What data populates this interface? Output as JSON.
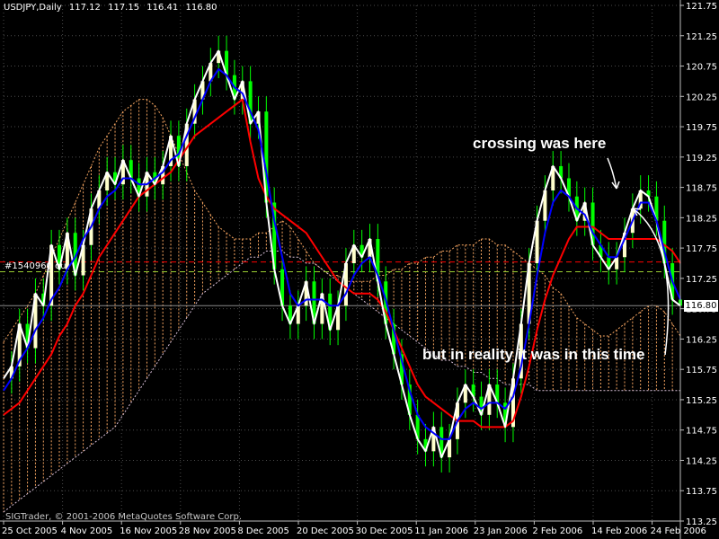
{
  "header": {
    "symbol": "USDJPY,Daily",
    "open": "117.12",
    "high": "117.15",
    "low": "116.41",
    "close": "116.80"
  },
  "copyright": "SIGTrader, © 2001-2006 MetaQuotes Software Corp.",
  "level_label": "#1540960 ou",
  "current_price": "116.80",
  "annotations": {
    "crossing": "crossing was here",
    "reality": "but in reality it was in this time"
  },
  "colors": {
    "background": "#000000",
    "price_line": "#ffffff",
    "tenkan": "#0000ff",
    "kijun": "#ff0000",
    "bull_candle": "#ffffcc",
    "bear_candle": "#00ff00",
    "cloud_up": "#f4a460",
    "cloud_down": "#d8bfd8",
    "grid": "#4a4a4a",
    "level_red": "#ff0000",
    "level_green": "#9acd32"
  },
  "chart_data": {
    "type": "line",
    "title": "USDJPY,Daily",
    "ylim": [
      113.25,
      121.75
    ],
    "y_ticks": [
      "121.75",
      "121.25",
      "120.75",
      "120.25",
      "119.75",
      "119.25",
      "118.75",
      "118.25",
      "117.75",
      "117.25",
      "116.75",
      "116.25",
      "115.75",
      "115.25",
      "114.75",
      "114.25",
      "113.75",
      "113.25"
    ],
    "x_ticks": [
      "25 Oct 2005",
      "4 Nov 2005",
      "16 Nov 2005",
      "28 Nov 2005",
      "8 Dec 2005",
      "20 Dec 2005",
      "30 Dec 2005",
      "11 Jan 2006",
      "23 Jan 2006",
      "2 Feb 2006",
      "14 Feb 2006",
      "24 Feb 2006"
    ],
    "grid": true,
    "levels": [
      {
        "value": 117.52,
        "color": "#ff0000"
      },
      {
        "value": 117.36,
        "color": "#9acd32"
      }
    ],
    "series": [
      {
        "key": "price",
        "values": [
          115.6,
          115.8,
          116.5,
          116.1,
          117.0,
          116.8,
          117.8,
          117.4,
          118.0,
          117.3,
          117.8,
          118.4,
          118.7,
          119.0,
          118.8,
          119.2,
          118.9,
          118.6,
          119.0,
          118.8,
          119.1,
          119.6,
          119.1,
          119.8,
          120.2,
          120.5,
          120.8,
          121.0,
          120.6,
          120.2,
          120.5,
          119.8,
          120.0,
          118.5,
          117.4,
          116.8,
          116.5,
          116.8,
          117.2,
          116.5,
          117.0,
          116.4,
          116.8,
          117.5,
          117.8,
          117.6,
          117.9,
          117.2,
          116.5,
          116.0,
          115.5,
          115.0,
          114.6,
          114.4,
          114.8,
          114.3,
          114.6,
          115.2,
          115.5,
          115.3,
          115.0,
          115.5,
          115.2,
          114.8,
          115.6,
          116.5,
          117.5,
          118.2,
          118.7,
          119.1,
          118.9,
          118.6,
          118.2,
          118.5,
          117.8,
          117.6,
          117.4,
          117.6,
          118.0,
          118.4,
          118.7,
          118.6,
          118.2,
          117.5,
          116.9,
          116.8
        ]
      },
      {
        "key": "tenkan",
        "values": [
          115.4,
          115.6,
          115.9,
          116.1,
          116.4,
          116.6,
          116.9,
          117.1,
          117.4,
          117.6,
          117.9,
          118.1,
          118.4,
          118.6,
          118.7,
          118.9,
          118.9,
          118.8,
          118.8,
          118.9,
          119.0,
          119.2,
          119.3,
          119.6,
          119.9,
          120.2,
          120.5,
          120.7,
          120.6,
          120.4,
          120.3,
          120.0,
          119.7,
          119.0,
          118.2,
          117.6,
          117.0,
          116.8,
          116.9,
          116.9,
          116.9,
          116.8,
          116.8,
          117.0,
          117.3,
          117.5,
          117.6,
          117.3,
          116.9,
          116.4,
          115.9,
          115.4,
          115.0,
          114.8,
          114.7,
          114.6,
          114.6,
          114.9,
          115.1,
          115.2,
          115.1,
          115.2,
          115.2,
          115.1,
          115.3,
          115.8,
          116.5,
          117.3,
          118.0,
          118.5,
          118.7,
          118.6,
          118.4,
          118.3,
          118.0,
          117.8,
          117.6,
          117.6,
          117.9,
          118.2,
          118.5,
          118.5,
          118.2,
          117.7,
          117.2,
          116.9
        ]
      },
      {
        "key": "kijun",
        "values": [
          115.0,
          115.1,
          115.2,
          115.4,
          115.6,
          115.8,
          116.0,
          116.3,
          116.5,
          116.8,
          117.0,
          117.3,
          117.6,
          117.8,
          118.0,
          118.2,
          118.4,
          118.6,
          118.7,
          118.8,
          118.9,
          119.0,
          119.2,
          119.4,
          119.6,
          119.7,
          119.8,
          119.9,
          120.0,
          120.1,
          120.2,
          119.5,
          118.9,
          118.6,
          118.4,
          118.3,
          118.2,
          118.1,
          118.0,
          117.8,
          117.6,
          117.4,
          117.2,
          117.1,
          117.0,
          117.0,
          117.0,
          116.9,
          116.7,
          116.4,
          116.1,
          115.8,
          115.5,
          115.3,
          115.2,
          115.1,
          115.0,
          114.9,
          114.9,
          114.9,
          114.8,
          114.8,
          114.8,
          114.8,
          114.9,
          115.3,
          115.8,
          116.4,
          116.9,
          117.3,
          117.6,
          117.9,
          118.1,
          118.1,
          118.1,
          118.0,
          117.9,
          117.9,
          117.9,
          117.9,
          117.9,
          117.9,
          117.9,
          117.8,
          117.7,
          117.5
        ]
      },
      {
        "key": "span_a",
        "values": [
          116.2,
          116.4,
          116.6,
          116.8,
          117.0,
          117.3,
          117.6,
          117.9,
          118.2,
          118.5,
          118.8,
          119.1,
          119.4,
          119.6,
          119.8,
          120.0,
          120.1,
          120.2,
          120.2,
          120.1,
          119.9,
          119.6,
          119.3,
          119.0,
          118.7,
          118.5,
          118.3,
          118.1,
          118.0,
          117.9,
          117.9,
          117.9,
          118.0,
          118.0,
          118.1,
          118.2,
          118.1,
          117.9,
          117.7,
          117.5,
          117.4,
          117.3,
          117.3,
          117.2,
          117.2,
          117.2,
          117.2,
          117.3,
          117.3,
          117.4,
          117.4,
          117.5,
          117.5,
          117.6,
          117.6,
          117.7,
          117.7,
          117.8,
          117.8,
          117.8,
          117.9,
          117.9,
          117.8,
          117.8,
          117.7,
          117.6,
          117.5,
          117.4,
          117.3,
          117.1,
          117.0,
          116.8,
          116.6,
          116.5,
          116.4,
          116.3,
          116.3,
          116.4,
          116.5,
          116.6,
          116.7,
          116.8,
          116.8,
          116.7,
          116.5,
          116.3
        ]
      },
      {
        "key": "span_b",
        "values": [
          113.4,
          113.5,
          113.6,
          113.7,
          113.8,
          113.9,
          114.0,
          114.1,
          114.2,
          114.3,
          114.4,
          114.5,
          114.6,
          114.7,
          114.8,
          115.0,
          115.2,
          115.4,
          115.6,
          115.8,
          116.0,
          116.2,
          116.4,
          116.6,
          116.8,
          117.0,
          117.1,
          117.2,
          117.3,
          117.4,
          117.5,
          117.6,
          117.6,
          117.7,
          117.7,
          117.7,
          117.6,
          117.6,
          117.5,
          117.5,
          117.4,
          117.3,
          117.2,
          117.1,
          117.0,
          116.9,
          116.8,
          116.7,
          116.6,
          116.5,
          116.4,
          116.3,
          116.2,
          116.1,
          116.0,
          115.9,
          115.9,
          115.8,
          115.8,
          115.7,
          115.7,
          115.6,
          115.6,
          115.5,
          115.5,
          115.5,
          115.5,
          115.4,
          115.4,
          115.4,
          115.4,
          115.4,
          115.4,
          115.4,
          115.4,
          115.4,
          115.4,
          115.4,
          115.4,
          115.4,
          115.4,
          115.4,
          115.4,
          115.4,
          115.4,
          115.4
        ]
      }
    ]
  }
}
